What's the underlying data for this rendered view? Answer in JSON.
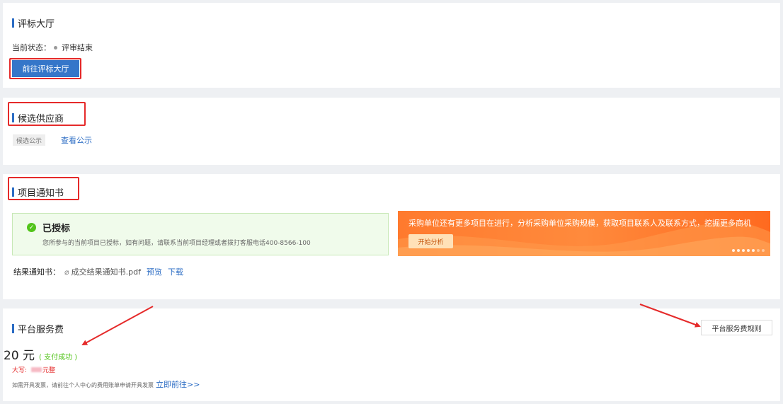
{
  "bid_hall": {
    "title": "评标大厅",
    "status_label": "当前状态：",
    "status_value": "评审结束",
    "goto_button": "前往评标大厅"
  },
  "candidate": {
    "title": "候选供应商",
    "tag": "候选公示",
    "view_link": "查看公示"
  },
  "notice": {
    "title": "项目通知书",
    "success_title": "已授标",
    "success_desc": "您所参与的当前项目已授标，如有问题，请联系当前项目经理或者拨打客服电话400-8566-100",
    "banner_text": "采购单位还有更多项目在进行，分析采购单位采购规模，获取项目联系人及联系方式，挖掘更多商机",
    "banner_button": "开始分析",
    "result_label": "结果通知书：",
    "file_name": "成交结果通知书.pdf",
    "preview_link": "预览",
    "download_link": "下载"
  },
  "service_fee": {
    "title": "平台服务费",
    "amount": "20 元",
    "pay_status": "( 支付成功 )",
    "capital_label": "大写:",
    "capital_suffix": "元整",
    "invoice_hint": "如需开具发票，请前往个人中心的费用账单申请开具发票",
    "invoice_link": "立即前往>>",
    "rule_button": "平台服务费规则"
  },
  "colors": {
    "accent_blue": "#2b6cc4",
    "primary_button": "#3576c9",
    "highlight_red": "#e52a2a",
    "success_green": "#52c41a",
    "banner_orange": "#ff7a2e"
  },
  "icons": {
    "success": "check-circle-icon",
    "attachment": "paperclip-icon",
    "status_dot": "dot-icon"
  }
}
